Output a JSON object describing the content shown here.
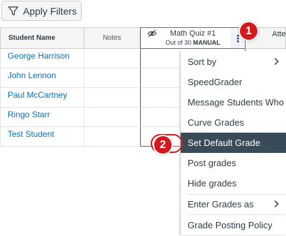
{
  "toolbar": {
    "apply_filters": "Apply Filters"
  },
  "headers": {
    "student": "Student Name",
    "notes": "Notes",
    "quiz_title": "Math Quiz #1",
    "quiz_sub_prefix": "Out of 30",
    "quiz_sub_flag": "MANUAL",
    "next_col": "Atte"
  },
  "students": [
    {
      "name": "George Harrison"
    },
    {
      "name": "John Lennon"
    },
    {
      "name": "Paul McCartney"
    },
    {
      "name": "Ringo Starr"
    },
    {
      "name": "Test Student"
    }
  ],
  "menu": {
    "items": [
      {
        "label": "Sort by",
        "submenu": true
      },
      {
        "label": "SpeedGrader"
      },
      {
        "label": "Message Students Who"
      },
      {
        "label": "Curve Grades"
      },
      {
        "label": "Set Default Grade",
        "active": true
      },
      {
        "label": "Post grades"
      },
      {
        "label": "Hide grades"
      },
      {
        "label": "Enter Grades as",
        "submenu": true
      },
      {
        "label": "Grade Posting Policy"
      }
    ]
  },
  "callouts": {
    "one": "1",
    "two": "2"
  },
  "colors": {
    "link": "#0b6fb8",
    "highlight_border": "#2d7ac6",
    "menu_active_bg": "#394b58",
    "callout_red": "#d4181c"
  },
  "icons": {
    "filter": "filter-icon",
    "eye": "eye-slash-icon",
    "kebab": "kebab-menu-icon",
    "chevron": "chevron-right-icon"
  }
}
